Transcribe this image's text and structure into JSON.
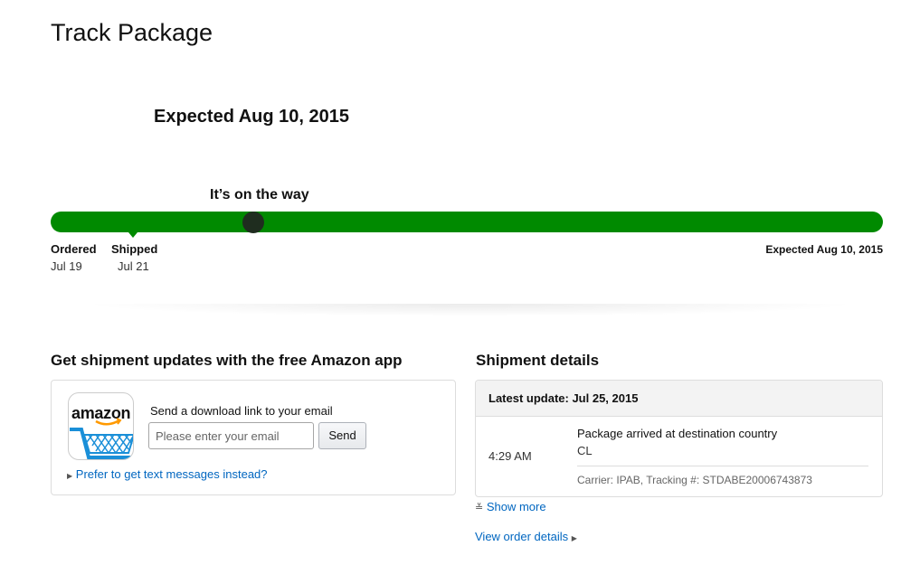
{
  "page": {
    "title": "Track Package"
  },
  "delivery": {
    "expected_heading": "Expected Aug 10, 2015",
    "status": "It’s on the way",
    "progress_fraction": 0.243
  },
  "milestones": [
    {
      "label": "Ordered",
      "date": "Jul 19"
    },
    {
      "label": "Shipped",
      "date": "Jul 21"
    },
    {
      "label": "Expected Aug 10, 2015",
      "date": ""
    }
  ],
  "app_promo": {
    "heading": "Get shipment updates with the free Amazon app",
    "logo_text": "amazon",
    "prompt": "Send a download link to your email",
    "email_placeholder": "Please enter your email",
    "email_value": "",
    "send_label": "Send",
    "sms_link": "Prefer to get text messages instead?"
  },
  "shipment": {
    "heading": "Shipment details",
    "latest_update": "Latest update: Jul 25, 2015",
    "event": {
      "time": "4:29 AM",
      "description": "Package arrived at destination country",
      "location": "CL",
      "carrier": "Carrier: IPAB, Tracking #: STDABE20006743873"
    },
    "show_more": "Show more",
    "view_order": "View order details"
  },
  "colors": {
    "progress": "#008a00",
    "marker": "#1f2d1f",
    "link": "#0066c0",
    "cart_blue": "#1a8fd8",
    "smile_orange": "#ff9900"
  },
  "icons": [
    "amazon-logo-icon",
    "shopping-cart-icon",
    "caret-right-icon",
    "double-chevron-down-icon"
  ]
}
